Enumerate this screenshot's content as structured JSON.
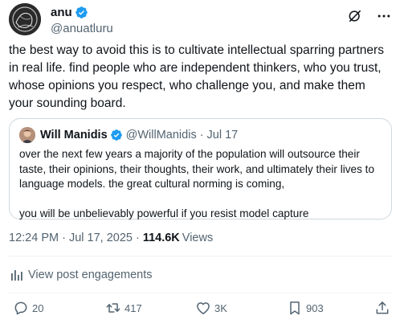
{
  "post": {
    "author_name": "anu",
    "author_handle": "@anuatluru",
    "text": "the best way to avoid this is to cultivate intellectual sparring partners in real life. find people who are independent thinkers, who you trust, whose opinions you respect, who challenge you, and make them your sounding board.",
    "timestamp": "12:24 PM · Jul 17, 2025",
    "views_count": "114.6K",
    "views_label": "Views",
    "separator": "·"
  },
  "quote": {
    "author_name": "Will Manidis",
    "author_handle": "@WillManidis",
    "separator": "·",
    "date": "Jul 17",
    "paragraph_1": "over the next few years a majority of the population will outsource their taste, their opinions, their thoughts, their work, and ultimately their lives to language models. the great cultural norming is coming,",
    "paragraph_2": "you will be unbelievably powerful if you resist model capture"
  },
  "engagements_link": "View post engagements",
  "actions": {
    "replies": "20",
    "reposts": "417",
    "likes": "3K",
    "bookmarks": "903"
  },
  "icons": [
    "grok-icon",
    "more-icon",
    "verified-badge-icon",
    "analytics-icon",
    "reply-icon",
    "repost-icon",
    "like-icon",
    "bookmark-icon",
    "share-icon"
  ],
  "colors": {
    "verified_blue": "#1d9bf0",
    "text_primary": "#0f1419",
    "text_secondary": "#536471",
    "border": "#cfd9de"
  }
}
